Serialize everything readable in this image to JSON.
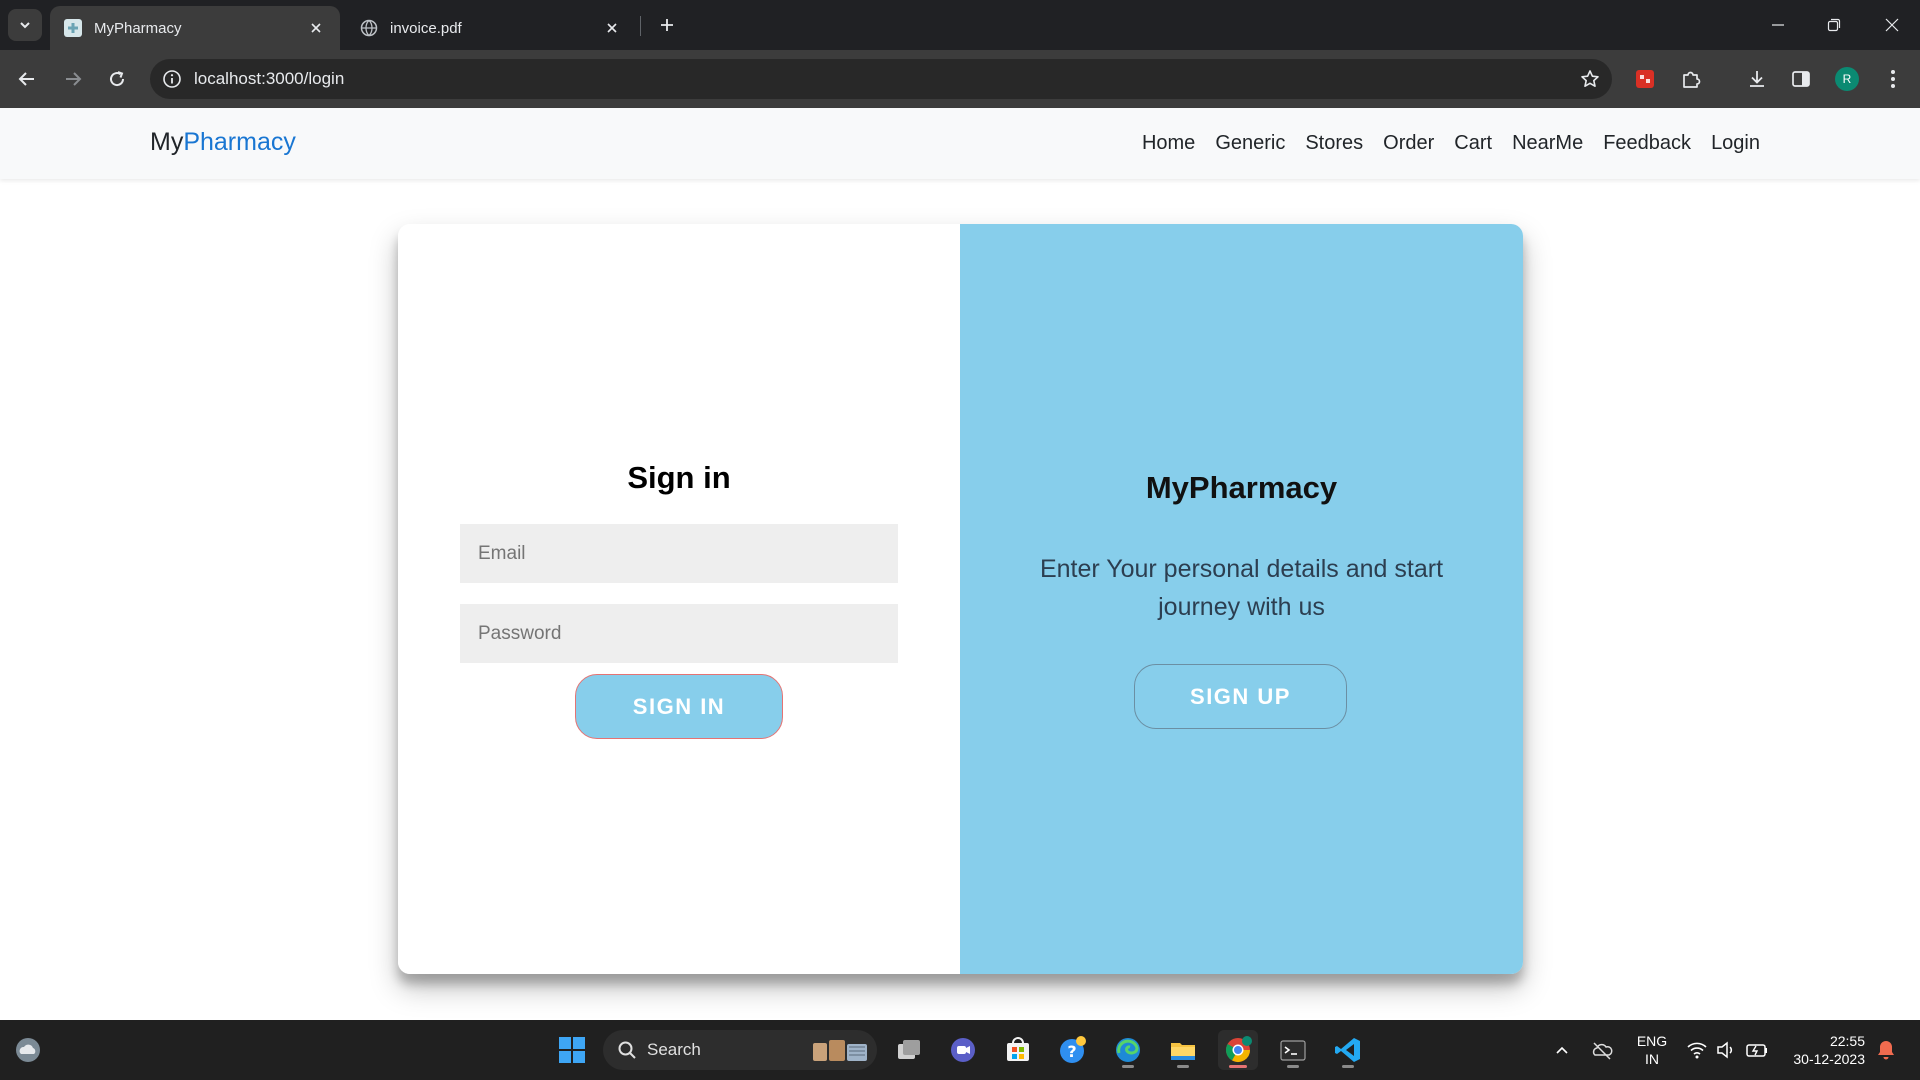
{
  "browser": {
    "tabs": [
      {
        "title": "MyPharmacy",
        "active": true
      },
      {
        "title": "invoice.pdf",
        "active": false
      }
    ],
    "url": "localhost:3000/login",
    "profile_initial": "R"
  },
  "navbar": {
    "brand_prefix": "My",
    "brand_accent": "Pharmacy",
    "links": [
      "Home",
      "Generic",
      "Stores",
      "Order",
      "Cart",
      "NearMe",
      "Feedback",
      "Login"
    ]
  },
  "signin": {
    "title": "Sign in",
    "email_placeholder": "Email",
    "password_placeholder": "Password",
    "button_label": "SIGN IN"
  },
  "overlay": {
    "title": "MyPharmacy",
    "text": "Enter Your personal details and start journey with us",
    "button_label": "SIGN UP"
  },
  "taskbar": {
    "search_label": "Search",
    "language_line1": "ENG",
    "language_line2": "IN",
    "time": "22:55",
    "date": "30-12-2023"
  },
  "colors": {
    "brand_accent": "#1976d2",
    "panel_blue": "#87ceeb",
    "signin_button_border": "#e57373"
  }
}
